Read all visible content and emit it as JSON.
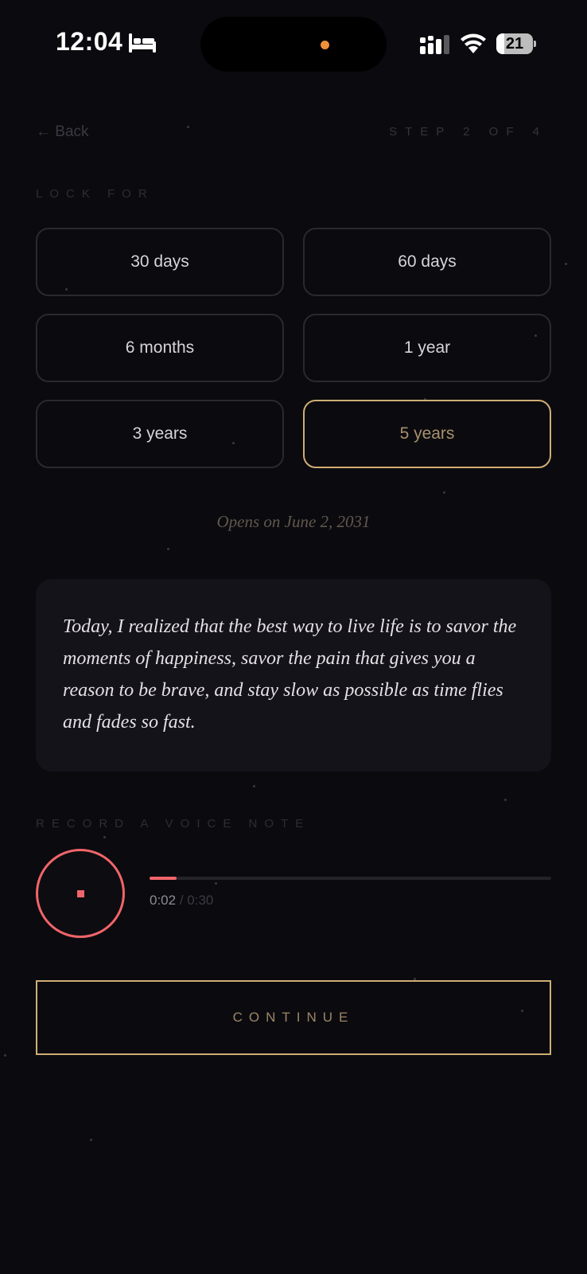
{
  "status_bar": {
    "time": "12:04",
    "battery": "21",
    "colors": {
      "island_dot": "#f0903a"
    }
  },
  "header": {
    "back_label": "← Back",
    "step_label": "STEP 2 OF 4"
  },
  "lock": {
    "section_label": "LOCK FOR",
    "options": [
      {
        "label": "30 days",
        "selected": false
      },
      {
        "label": "60 days",
        "selected": false
      },
      {
        "label": "6 months",
        "selected": false
      },
      {
        "label": "1 year",
        "selected": false
      },
      {
        "label": "3 years",
        "selected": false
      },
      {
        "label": "5 years",
        "selected": true
      }
    ],
    "opens_on": "Opens on June 2, 2031"
  },
  "note": {
    "text": "Today, I realized that the best way to live life is to savor the moments of happiness, savor the pain that gives you a reason to be brave, and stay slow as possible as time flies and fades so fast."
  },
  "voice_note": {
    "section_label": "RECORD A VOICE NOTE",
    "current_time": "0:02",
    "separator": " / ",
    "total_time": "0:30",
    "progress_fraction": 0.067
  },
  "actions": {
    "continue_label": "CONTINUE"
  },
  "colors": {
    "accent_gold": "#cfae75",
    "record_red": "#f0656a",
    "background": "#0b0a0f"
  }
}
